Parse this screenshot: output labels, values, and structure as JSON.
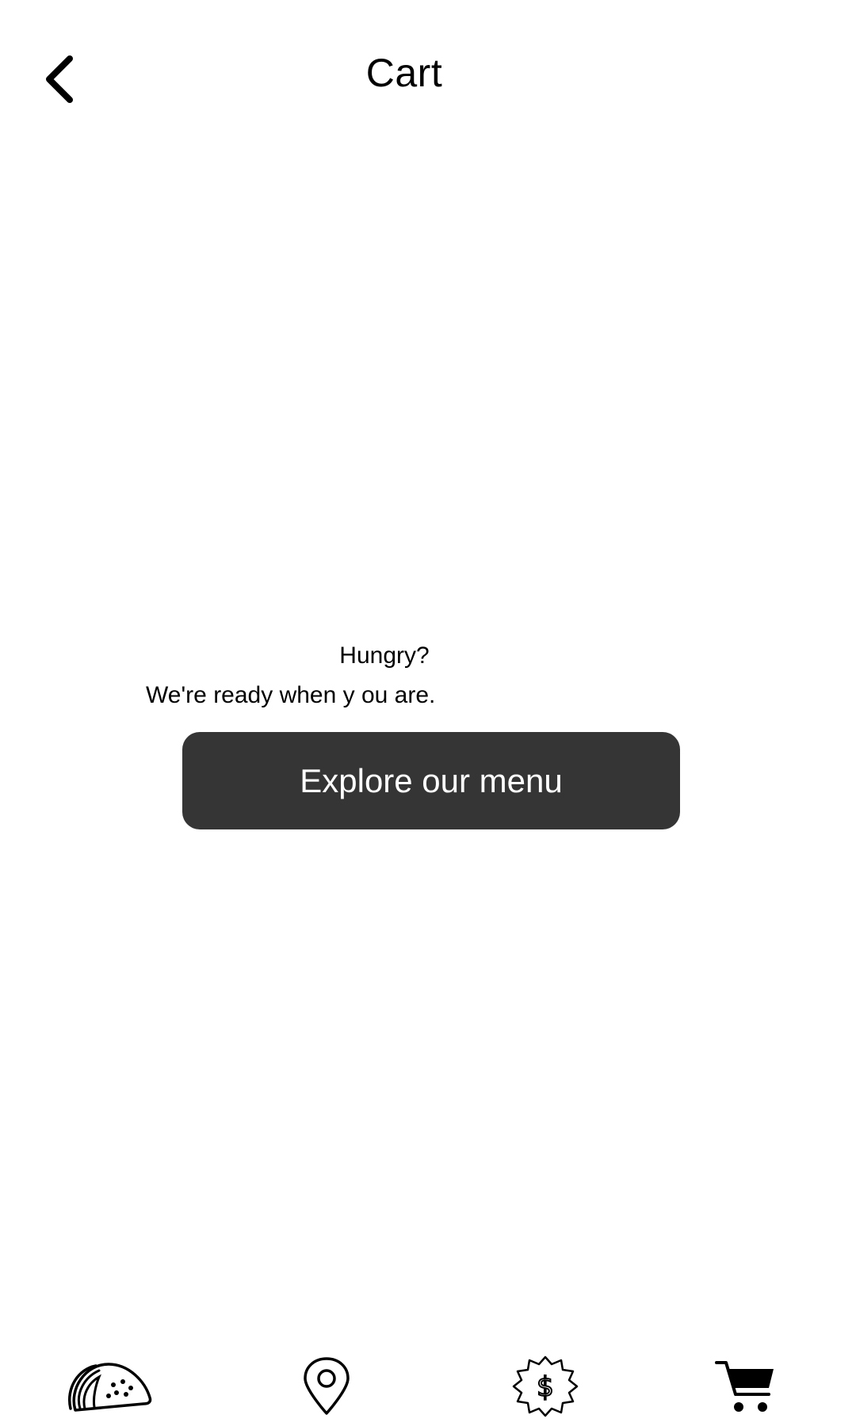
{
  "header": {
    "title": "Cart",
    "back_icon": "chevron-left-icon"
  },
  "empty_cart": {
    "heading": "Hungry?",
    "message": "We're ready when y ou are.",
    "button_label": "Explore our menu"
  },
  "tabbar": {
    "tabs": [
      {
        "icon": "taco-icon",
        "target": "menu"
      },
      {
        "icon": "location-pin-icon",
        "target": "locations"
      },
      {
        "icon": "rewards-dollar-badge-icon",
        "target": "rewards"
      },
      {
        "icon": "cart-icon",
        "target": "cart",
        "active": true
      }
    ]
  },
  "colors": {
    "background": "#ffffff",
    "text": "#000000",
    "button_background": "#353535",
    "button_text": "#ffffff"
  }
}
